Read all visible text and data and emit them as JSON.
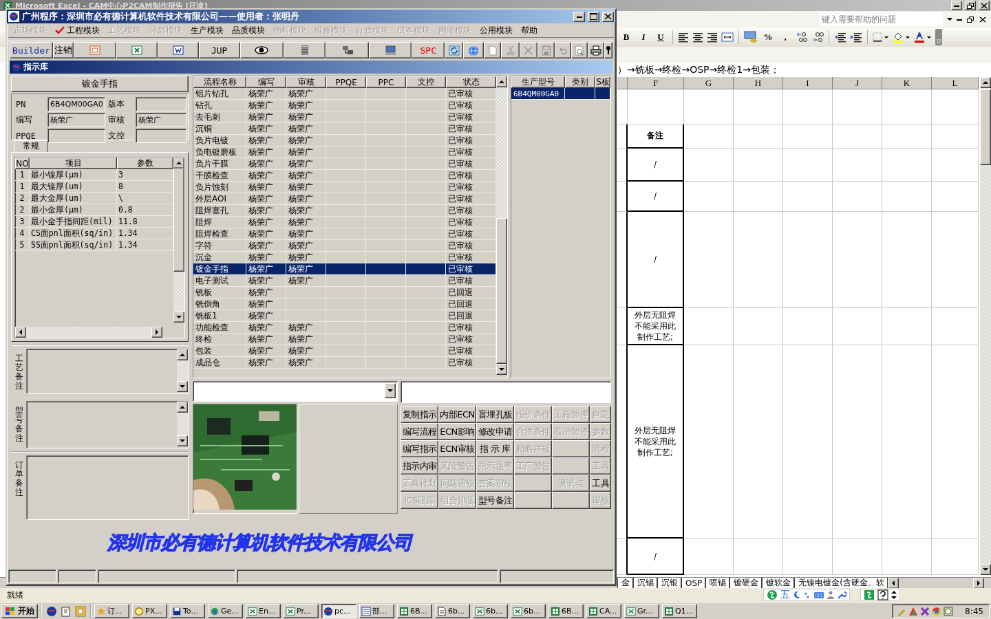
{
  "excel": {
    "title": "Microsoft Excel - CAM中心P2CAM制作报告 [只读]",
    "help_box": {
      "placeholder": "键入需要帮助的问题"
    },
    "format_buttons": [
      "B",
      "I",
      "U"
    ],
    "number_buttons": [
      "%",
      ","
    ],
    "formula": "）→铣板→终检→OSP→终检1→包装；",
    "columns": [
      "F",
      "G",
      "H",
      "I",
      "J",
      "K",
      "L"
    ],
    "remarks_header": "备注",
    "remarks": [
      "/",
      "/",
      "/",
      "外层无阻焊不能采用此制作工艺;",
      "外层无阻焊不能采用此制作工艺;",
      "/"
    ],
    "sheet_tabs": [
      "金",
      "沉锡",
      "沉银",
      "OSP",
      "喷锡",
      "镀硬金",
      "镀软金",
      "无镍电镀金(含硬金、软"
    ],
    "status": "就绪",
    "ime": "五"
  },
  "app": {
    "title": "广州程序：深圳市必有德计算机软件技术有限公司——使用者：张明丹",
    "menu": [
      {
        "label": "市场模块",
        "disabled": true,
        "checked": false
      },
      {
        "label": "工程模块",
        "disabled": false,
        "checked": true
      },
      {
        "label": "工艺模块",
        "disabled": true,
        "checked": false
      },
      {
        "label": "计划模块",
        "disabled": true,
        "checked": false
      },
      {
        "label": "生产模块",
        "disabled": false,
        "checked": false
      },
      {
        "label": "品质模块",
        "disabled": false,
        "checked": false
      },
      {
        "label": "物料模块",
        "disabled": true,
        "checked": false
      },
      {
        "label": "维修模块",
        "disabled": true,
        "checked": false
      },
      {
        "label": "行政模块",
        "disabled": true,
        "checked": false
      },
      {
        "label": "成本模块",
        "disabled": true,
        "checked": false
      },
      {
        "label": "网络模块",
        "disabled": true,
        "checked": false
      },
      {
        "label": "公用模块",
        "disabled": false,
        "checked": false
      },
      {
        "label": "帮助",
        "disabled": false,
        "checked": false
      }
    ],
    "toolbar": [
      "Builder",
      "注销",
      "JUP",
      "SPC"
    ],
    "child_title": "指示库",
    "process_title": "镀金手指",
    "fields": [
      {
        "label": "PN",
        "value": "6B4QM00GA0"
      },
      {
        "label": "版本"
      },
      {
        "label": "编写",
        "value": "杨荣广"
      },
      {
        "label": "审核",
        "value": "杨荣广"
      },
      {
        "label": "PPQE"
      },
      {
        "label": "文控"
      }
    ],
    "tabs": [
      {
        "label": "常规",
        "selected": true
      }
    ],
    "params": {
      "columns": [
        "NO",
        "项目",
        "参数"
      ],
      "rows": [
        {
          "no": "1",
          "item": "最小镍厚(μm)",
          "value": "3"
        },
        {
          "no": "1",
          "item": "最大镍厚(um)",
          "value": "8"
        },
        {
          "no": "2",
          "item": "最大金厚(um)",
          "value": "\\"
        },
        {
          "no": "2",
          "item": "最小金厚(μm)",
          "value": "0.8"
        },
        {
          "no": "3",
          "item": "最小金手指间距(mil)",
          "value": "11.8"
        },
        {
          "no": "4",
          "item": "CS面pnl面积(sq/in)",
          "value": "1.34"
        },
        {
          "no": "5",
          "item": "SS面pnl面积(sq/in)",
          "value": "1.34"
        }
      ]
    },
    "notes": [
      "工艺备注",
      "型号备注",
      "订单备注"
    ],
    "flow": {
      "columns": [
        "流程名称",
        "编写",
        "审核",
        "PPQE",
        "PPC",
        "文控",
        "状态"
      ],
      "rows": [
        {
          "name": "铝片钻孔",
          "writer": "杨荣广",
          "reviewer": "杨荣广",
          "status": "已审核",
          "selected": false
        },
        {
          "name": "钻孔",
          "writer": "杨荣广",
          "reviewer": "杨荣广",
          "status": "已审核",
          "selected": false
        },
        {
          "name": "去毛刺",
          "writer": "杨荣广",
          "reviewer": "杨荣广",
          "status": "已审核",
          "selected": false
        },
        {
          "name": "沉铜",
          "writer": "杨荣广",
          "reviewer": "杨荣广",
          "status": "已审核",
          "selected": false
        },
        {
          "name": "负片电镀",
          "writer": "杨荣广",
          "reviewer": "杨荣广",
          "status": "已审核",
          "selected": false
        },
        {
          "name": "负电镀磨板",
          "writer": "杨荣广",
          "reviewer": "杨荣广",
          "status": "已审核",
          "selected": false
        },
        {
          "name": "负片干膜",
          "writer": "杨荣广",
          "reviewer": "杨荣广",
          "status": "已审核",
          "selected": false
        },
        {
          "name": "干膜检查",
          "writer": "杨荣广",
          "reviewer": "杨荣广",
          "status": "已审核",
          "selected": false
        },
        {
          "name": "负片蚀刻",
          "writer": "杨荣广",
          "reviewer": "杨荣广",
          "status": "已审核",
          "selected": false
        },
        {
          "name": "外层AOI",
          "writer": "杨荣广",
          "reviewer": "杨荣广",
          "status": "已审核",
          "selected": false
        },
        {
          "name": "阻焊塞孔",
          "writer": "杨荣广",
          "reviewer": "杨荣广",
          "status": "已审核",
          "selected": false
        },
        {
          "name": "阻焊",
          "writer": "杨荣广",
          "reviewer": "杨荣广",
          "status": "已审核",
          "selected": false
        },
        {
          "name": "阻焊检查",
          "writer": "杨荣广",
          "reviewer": "杨荣广",
          "status": "已审核",
          "selected": false
        },
        {
          "name": "字符",
          "writer": "杨荣广",
          "reviewer": "杨荣广",
          "status": "已审核",
          "selected": false
        },
        {
          "name": "沉金",
          "writer": "杨荣广",
          "reviewer": "杨荣广",
          "status": "已审核",
          "selected": false
        },
        {
          "name": "镀金手指",
          "writer": "杨荣广",
          "reviewer": "杨荣广",
          "status": "已审核",
          "selected": true
        },
        {
          "name": "电子测试",
          "writer": "杨荣广",
          "reviewer": "杨荣广",
          "status": "已审核",
          "selected": false
        },
        {
          "name": "铣板",
          "writer": "杨荣广",
          "status": "已回退",
          "selected": false
        },
        {
          "name": "铣倒角",
          "writer": "杨荣广",
          "status": "已回退",
          "selected": false
        },
        {
          "name": "铣板1",
          "writer": "杨荣广",
          "status": "已回退",
          "selected": false
        },
        {
          "name": "功能检查",
          "writer": "杨荣广",
          "reviewer": "杨荣广",
          "status": "已审核",
          "selected": false
        },
        {
          "name": "终检",
          "writer": "杨荣广",
          "reviewer": "杨荣广",
          "status": "已审核",
          "selected": false
        },
        {
          "name": "包装",
          "writer": "杨荣广",
          "reviewer": "杨荣广",
          "status": "已审核",
          "selected": false
        },
        {
          "name": "成品仓",
          "writer": "杨荣广",
          "reviewer": "杨荣广",
          "status": "已审核",
          "selected": false
        }
      ]
    },
    "models": {
      "columns": [
        "生产型号",
        "类别",
        "S板"
      ],
      "rows": [
        {
          "model": "6B4QM00GA0",
          "selected": true
        }
      ]
    },
    "buttons": [
      {
        "kind": "button",
        "label": "复制指示",
        "disabled": false
      },
      {
        "kind": "button",
        "label": "内部ECN",
        "disabled": false
      },
      {
        "kind": "button",
        "label": "盲埋孔板",
        "disabled": false
      },
      {
        "kind": "button",
        "label": "报价条件",
        "disabled": true
      },
      {
        "kind": "button",
        "label": "工程暂停",
        "disabled": true
      },
      {
        "kind": "button",
        "label": "自定",
        "disabled": true
      },
      {
        "kind": "button",
        "label": "编写流程",
        "disabled": false
      },
      {
        "kind": "button",
        "label": "ECN影响",
        "disabled": false
      },
      {
        "kind": "button",
        "label": "修改申请",
        "disabled": false
      },
      {
        "kind": "button",
        "label": "合拼条件",
        "disabled": true
      },
      {
        "kind": "button",
        "label": "取消暂停",
        "disabled": true
      },
      {
        "kind": "button",
        "label": "参数",
        "disabled": true
      },
      {
        "kind": "button",
        "label": "编写指示",
        "disabled": false
      },
      {
        "kind": "button",
        "label": "ECN审核",
        "disabled": false
      },
      {
        "kind": "button",
        "label": "指 示 库",
        "disabled": false
      },
      {
        "kind": "button",
        "label": "粗略拼板",
        "disabled": true
      },
      {
        "kind": "blank"
      },
      {
        "kind": "button",
        "label": "流程",
        "disabled": true
      },
      {
        "kind": "button",
        "label": "指示内审",
        "disabled": false
      },
      {
        "kind": "button",
        "label": "风险警告",
        "disabled": true
      },
      {
        "kind": "button",
        "label": "指示退率",
        "disabled": true
      },
      {
        "kind": "button",
        "label": "工厂警告",
        "disabled": true
      },
      {
        "kind": "blank"
      },
      {
        "kind": "button",
        "label": "工具",
        "disabled": true
      },
      {
        "kind": "button",
        "label": "工具计划",
        "disabled": true
      },
      {
        "kind": "button",
        "label": "问题审核",
        "disabled": true
      },
      {
        "kind": "button",
        "label": "答案审核",
        "disabled": true
      },
      {
        "kind": "blank"
      },
      {
        "kind": "button",
        "label": "测试点",
        "disabled": true
      },
      {
        "kind": "button",
        "label": "工具",
        "disabled": false
      },
      {
        "kind": "button",
        "label": "ICS跟踪",
        "disabled": true
      },
      {
        "kind": "button",
        "label": "组合排版",
        "disabled": true
      },
      {
        "kind": "button",
        "label": "型号备注",
        "disabled": false
      },
      {
        "kind": "blank"
      },
      {
        "kind": "blank"
      },
      {
        "kind": "button",
        "label": "审核",
        "disabled": true
      }
    ],
    "logo": "深圳市必有德计算机软件技术有限公司"
  },
  "taskbar": {
    "start": "开始",
    "tasks": [
      {
        "label": "订...",
        "selected": false
      },
      {
        "label": "PX...",
        "selected": false
      },
      {
        "label": "To...",
        "selected": false
      },
      {
        "label": "Ge...",
        "selected": false
      },
      {
        "label": "En...",
        "selected": false
      },
      {
        "label": "Pr...",
        "selected": false
      },
      {
        "label": "pc...",
        "selected": true
      },
      {
        "label": "部...",
        "selected": false
      },
      {
        "label": "6B...",
        "selected": false
      },
      {
        "label": "6b...",
        "selected": false
      },
      {
        "label": "6b...",
        "selected": false
      },
      {
        "label": "6b...",
        "selected": false
      },
      {
        "label": "6B...",
        "selected": false
      },
      {
        "label": "CA...",
        "selected": false
      },
      {
        "label": "Gr...",
        "selected": false
      },
      {
        "label": "Q1...",
        "selected": false
      }
    ],
    "clock": "8:45"
  }
}
